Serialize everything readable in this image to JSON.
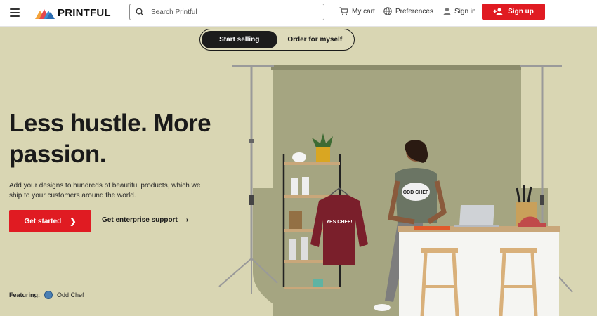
{
  "header": {
    "logo_text": "PRINTFUL",
    "search_placeholder": "Search Printful",
    "cart_label": "My cart",
    "preferences_label": "Preferences",
    "signin_label": "Sign in",
    "signup_label": "Sign up"
  },
  "toggle": {
    "active_label": "Start selling",
    "inactive_label": "Order for myself"
  },
  "hero": {
    "headline": "Less hustle. More passion.",
    "subtext": "Add your designs to hundreds of beautiful products, which we ship to your customers around the world.",
    "cta_label": "Get started",
    "enterprise_label": "Get enterprise support",
    "featuring_label": "Featuring:",
    "featuring_brand": "Odd Chef"
  },
  "scene": {
    "sweatshirt_text": "YES CHEF!",
    "tshirt_text": "ODD CHEF"
  },
  "colors": {
    "brand_red": "#e01b22",
    "hero_bg": "#d9d6b3",
    "backdrop": "#a5a581"
  }
}
